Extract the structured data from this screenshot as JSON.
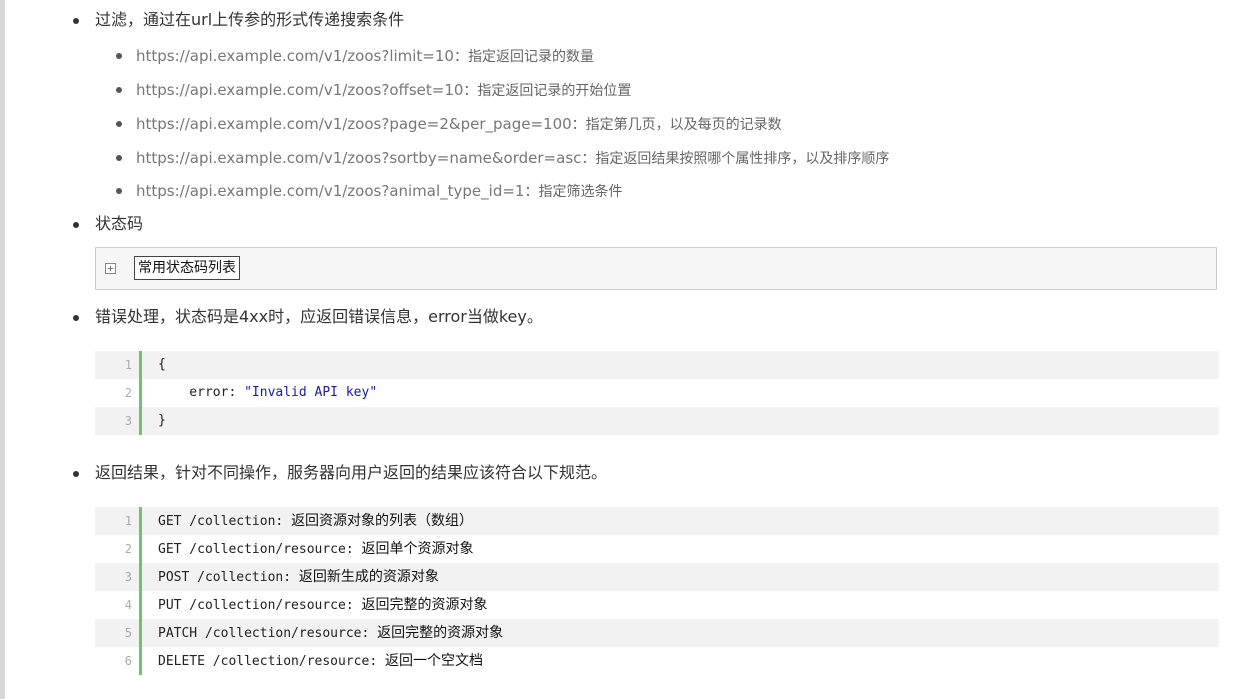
{
  "filter": {
    "heading": "过滤，通过在url上传参的形式传递搜索条件",
    "items": [
      {
        "url": "https://api.example.com/v1/zoos?limit=10",
        "desc": "：指定返回记录的数量"
      },
      {
        "url": "https://api.example.com/v1/zoos?offset=10",
        "desc": "：指定返回记录的开始位置"
      },
      {
        "url": "https://api.example.com/v1/zoos?page=2&per_page=100",
        "desc": "：指定第几页，以及每页的记录数"
      },
      {
        "url": "https://api.example.com/v1/zoos?sortby=name&order=asc",
        "desc": "：指定返回结果按照哪个属性排序，以及排序顺序"
      },
      {
        "url": "https://api.example.com/v1/zoos?animal_type_id=1",
        "desc": "：指定筛选条件"
      }
    ]
  },
  "status_codes": {
    "heading": "状态码",
    "collapsed_label": "常用状态码列表"
  },
  "error_handling": {
    "heading": "错误处理，状态码是4xx时，应返回错误信息，error当做key。",
    "code": [
      {
        "num": "1",
        "text": "{"
      },
      {
        "num": "2",
        "key": "    error: ",
        "str": "\"Invalid API key\""
      },
      {
        "num": "3",
        "text": "}"
      }
    ]
  },
  "results": {
    "heading": "返回结果，针对不同操作，服务器向用户返回的结果应该符合以下规范。",
    "code": [
      {
        "num": "1",
        "method": "GET /collection: ",
        "desc": "返回资源对象的列表（数组）"
      },
      {
        "num": "2",
        "method": "GET /collection/resource: ",
        "desc": "返回单个资源对象"
      },
      {
        "num": "3",
        "method": "POST /collection: ",
        "desc": "返回新生成的资源对象"
      },
      {
        "num": "4",
        "method": "PUT /collection/resource: ",
        "desc": "返回完整的资源对象"
      },
      {
        "num": "5",
        "method": "PATCH /collection/resource: ",
        "desc": "返回完整的资源对象"
      },
      {
        "num": "6",
        "method": "DELETE /collection/resource: ",
        "desc": "返回一个空文档"
      }
    ]
  },
  "colors": {
    "gutter_bar": "#6fc36f",
    "code_shade": "#f2f2f2",
    "string": "#1a1aa6"
  }
}
